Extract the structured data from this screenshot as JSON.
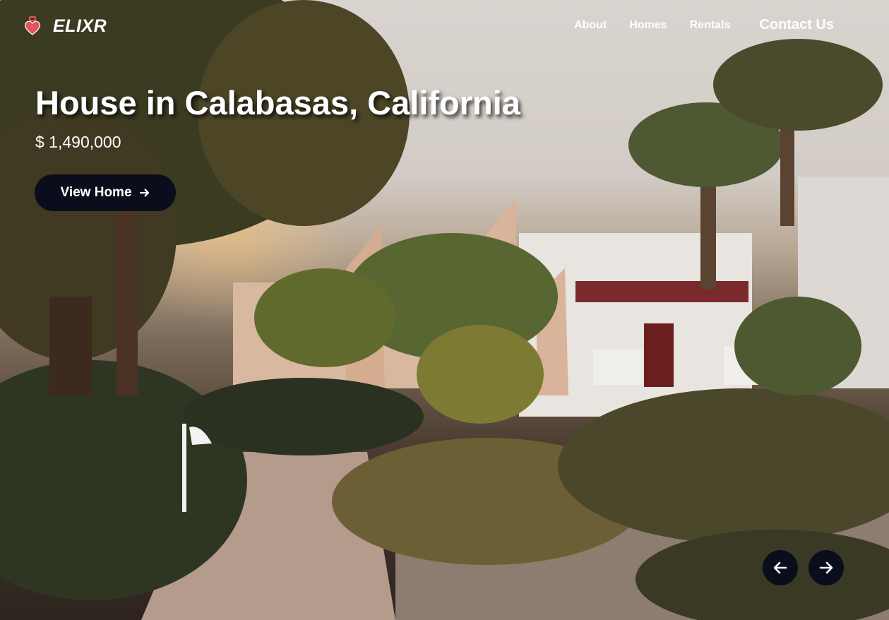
{
  "brand": {
    "name": "ELIXR",
    "icon": "heart-potion-icon"
  },
  "nav": {
    "about": "About",
    "homes": "Homes",
    "rentals": "Rentals",
    "contact": "Contact Us"
  },
  "hero": {
    "title": "House in Calabasas, California",
    "price": "$ 1,490,000",
    "cta_label": "View Home",
    "cta_icon": "arrow-right-icon"
  },
  "carousel": {
    "prev_icon": "arrow-left-icon",
    "next_icon": "arrow-right-icon"
  },
  "colors": {
    "button_bg": "#0a0d1c",
    "logo_accent": "#e3545c",
    "text": "#ffffff"
  }
}
